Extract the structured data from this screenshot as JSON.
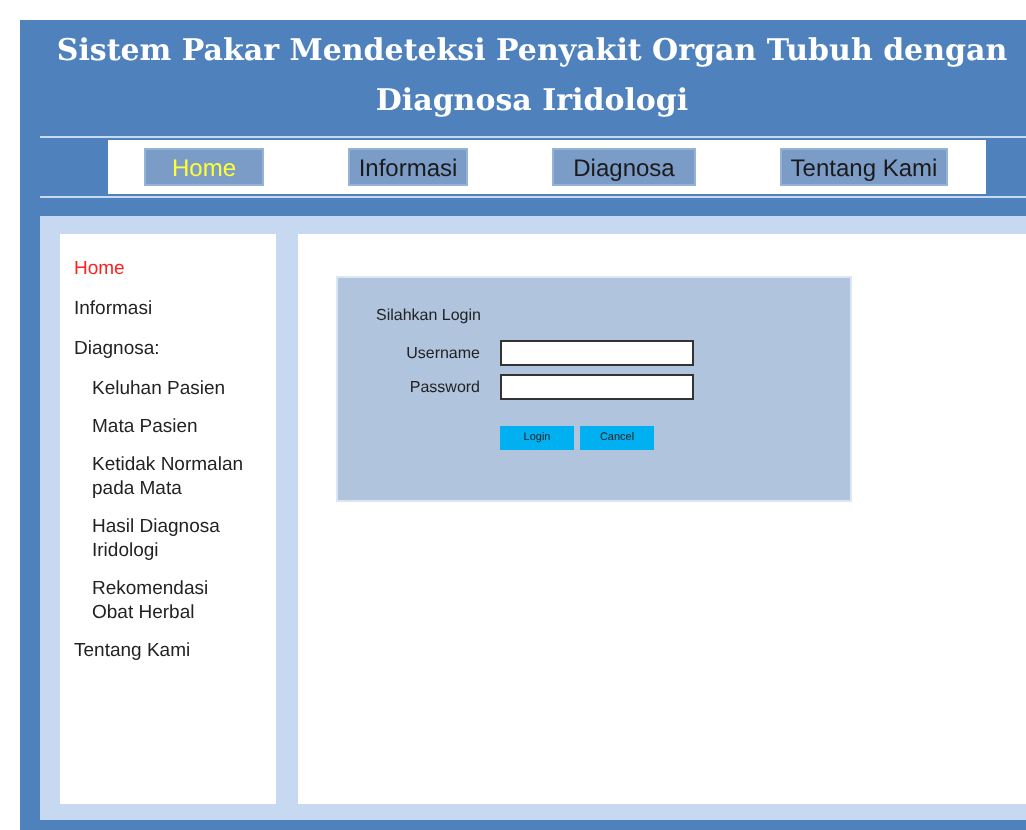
{
  "header": {
    "title": "Sistem Pakar Mendeteksi Penyakit Organ Tubuh dengan Diagnosa Iridologi"
  },
  "nav": [
    {
      "label": "Home",
      "selected": true
    },
    {
      "label": "Informasi",
      "selected": false
    },
    {
      "label": "Diagnosa",
      "selected": false
    },
    {
      "label": "Tentang Kami",
      "selected": false
    }
  ],
  "sidebar": {
    "items": [
      {
        "label": "Home",
        "selected": true
      },
      {
        "label": "Informasi",
        "selected": false
      },
      {
        "label": "Diagnosa:",
        "selected": false,
        "children": [
          {
            "label": "Keluhan Pasien",
            "selected": false
          },
          {
            "label": "Mata Pasien",
            "selected": false
          },
          {
            "label": "Ketidak Normalan pada Mata",
            "selected": false
          },
          {
            "label": "Hasil Diagnosa Iridologi",
            "selected": false
          },
          {
            "label": "Rekomendasi Obat Herbal",
            "selected": false
          }
        ]
      },
      {
        "label": "Tentang Kami",
        "selected": false
      }
    ]
  },
  "login": {
    "title": "Silahkan Login",
    "fields": [
      {
        "label": "Username"
      },
      {
        "label": "Password"
      }
    ],
    "buttons": [
      "Login",
      "Cancel"
    ]
  }
}
